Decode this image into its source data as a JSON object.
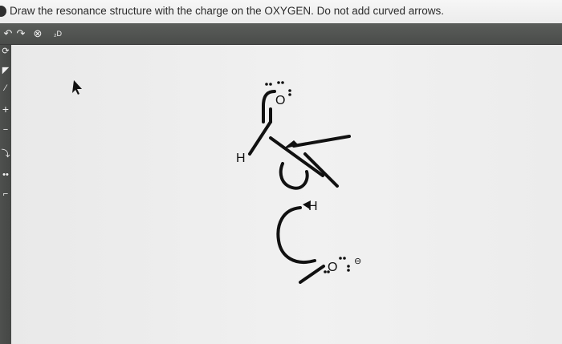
{
  "question": {
    "text": "Draw the resonance structure with the charge on the OXYGEN. Do not add curved arrows."
  },
  "toolbar": {
    "tools": [
      {
        "name": "undo-icon",
        "glyph": "↶"
      },
      {
        "name": "redo-icon",
        "glyph": "↷"
      },
      {
        "name": "zoom-icon",
        "glyph": "⊗"
      },
      {
        "name": "cleanup-2d-icon",
        "glyph": "₂D"
      }
    ]
  },
  "left_tools": [
    {
      "name": "lasso-tool-icon",
      "glyph": "⟳"
    },
    {
      "name": "eraser-tool-icon",
      "glyph": "◤"
    },
    {
      "name": "bond-tool-icon",
      "glyph": "⁄"
    },
    {
      "name": "positive-charge-icon",
      "glyph": "+"
    },
    {
      "name": "negative-charge-icon",
      "glyph": "−"
    },
    {
      "name": "arrow-tool-icon",
      "glyph": "⤵"
    },
    {
      "name": "lone-pair-icon",
      "glyph": "••"
    },
    {
      "name": "bracket-tool-icon",
      "glyph": "⌐"
    }
  ],
  "molecule": {
    "atoms": {
      "oxygen_top": "O",
      "hydrogen_left": "H",
      "hydrogen_mid": "H",
      "oxygen_bottom": "O",
      "negative_charge": "⊖"
    }
  }
}
